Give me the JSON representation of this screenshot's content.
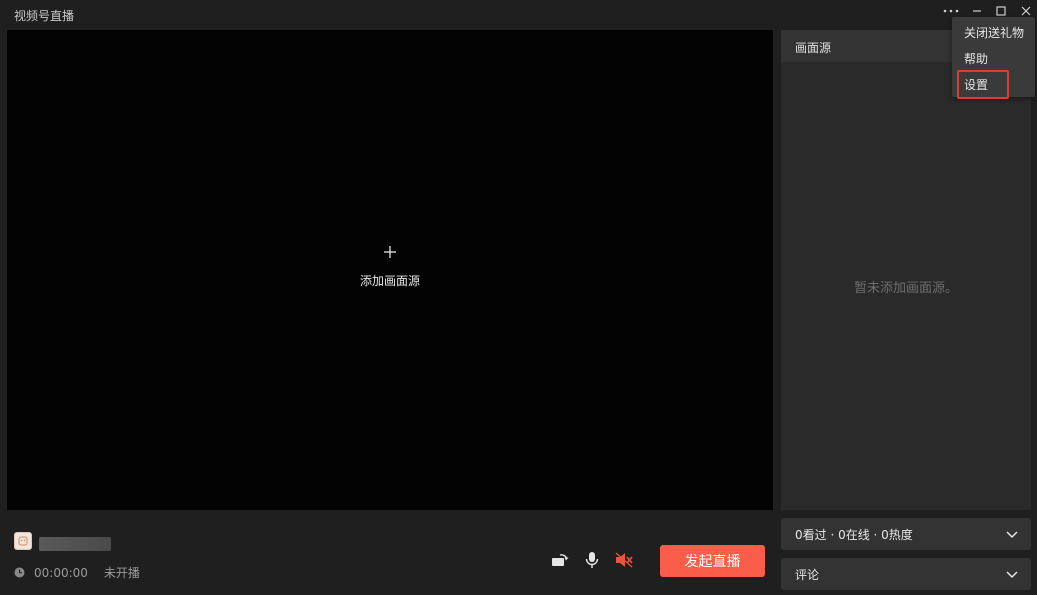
{
  "app": {
    "title": "视频号直播"
  },
  "preview": {
    "add_source_label": "添加画面源"
  },
  "sources_panel": {
    "title": "画面源",
    "empty_text": "暂未添加画面源。"
  },
  "footer": {
    "timer": "00:00:00",
    "status": "未开播",
    "start_button": "发起直播"
  },
  "stats_panel": {
    "label": "0看过 · 0在线 · 0热度"
  },
  "comments_panel": {
    "label": "评论"
  },
  "menu": {
    "items": [
      "关闭送礼物",
      "帮助",
      "设置"
    ],
    "highlighted": "设置"
  },
  "colors": {
    "accent": "#fa5d4a",
    "highlight": "#e43a2c",
    "mute": "#e8553f"
  },
  "icons": [
    "more-icon",
    "minimize-icon",
    "maximize-icon",
    "close-icon",
    "plus-icon",
    "clock-icon",
    "camera-rotate-icon",
    "microphone-icon",
    "speaker-muted-icon",
    "chevron-down-icon"
  ]
}
